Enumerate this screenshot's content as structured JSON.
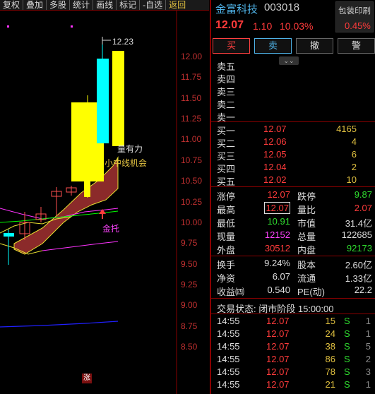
{
  "toolbar": [
    "复权",
    "叠加",
    "多股",
    "统计",
    "画线",
    "标记",
    "-自选",
    "返回"
  ],
  "chart": {
    "y_ticks": [
      "12.00",
      "11.75",
      "11.50",
      "11.25",
      "11.00",
      "10.75",
      "10.50",
      "10.25",
      "10.00",
      "9.75",
      "9.50",
      "9.25",
      "9.00",
      "8.75",
      "8.50"
    ],
    "high_label": "12.23",
    "annotations": [
      "量有力",
      "小中线机会",
      "金托"
    ],
    "zhang_badge": "涨",
    "colors": {
      "up_candle": "#ffff00",
      "cyan_candle": "#00ffff",
      "band_fill": "#8b2a2a",
      "ma_green": "#00ff00",
      "ma_magenta": "#ff33ff",
      "ma_blue": "#2020ff"
    }
  },
  "stock": {
    "name": "金富科技",
    "code": "003018",
    "price": "12.07",
    "change": "1.10",
    "change_pct": "10.03%",
    "baoyou_label": "包装印刷",
    "baoyou_pct": "0.45%"
  },
  "trade_buttons": [
    "买",
    "卖",
    "撤",
    "警"
  ],
  "sell_orders": [
    {
      "label": "卖五",
      "price": "",
      "vol": ""
    },
    {
      "label": "卖四",
      "price": "",
      "vol": ""
    },
    {
      "label": "卖三",
      "price": "",
      "vol": ""
    },
    {
      "label": "卖二",
      "price": "",
      "vol": ""
    },
    {
      "label": "卖一",
      "price": "",
      "vol": ""
    }
  ],
  "buy_orders": [
    {
      "label": "买一",
      "price": "12.07",
      "vol": "4165"
    },
    {
      "label": "买二",
      "price": "12.06",
      "vol": "4"
    },
    {
      "label": "买三",
      "price": "12.05",
      "vol": "6"
    },
    {
      "label": "买四",
      "price": "12.04",
      "vol": "2"
    },
    {
      "label": "买五",
      "price": "12.02",
      "vol": "10"
    }
  ],
  "quote": [
    {
      "k1": "涨停",
      "v1": "12.07",
      "c1": "red",
      "k2": "跌停",
      "v2": "9.87",
      "c2": "green"
    },
    {
      "k1": "最高",
      "v1": "12.07",
      "c1": "red",
      "k2": "量比",
      "v2": "2.07",
      "c2": "red"
    },
    {
      "k1": "最低",
      "v1": "10.91",
      "c1": "green",
      "k2": "市值",
      "v2": "31.4亿",
      "c2": "white"
    },
    {
      "k1": "现量",
      "v1": "12152",
      "c1": "purple",
      "k2": "总量",
      "v2": "122685",
      "c2": "white"
    },
    {
      "k1": "外盘",
      "v1": "30512",
      "c1": "red",
      "k2": "内盘",
      "v2": "92173",
      "c2": "green"
    }
  ],
  "fundamentals": [
    {
      "k1": "换手",
      "v1": "9.24%",
      "k2": "股本",
      "v2": "2.60亿"
    },
    {
      "k1": "净资",
      "v1": "6.07",
      "k2": "流通",
      "v2": "1.33亿"
    },
    {
      "k1": "收益㈣",
      "v1": "0.540",
      "k2": "PE(动)",
      "v2": "22.2"
    }
  ],
  "trade_status": "交易状态: 闭市阶段 15:00:00",
  "ticks": [
    {
      "time": "14:55",
      "price": "12.07",
      "vol": "15",
      "side": "S",
      "num": "1"
    },
    {
      "time": "14:55",
      "price": "12.07",
      "vol": "24",
      "side": "S",
      "num": "1"
    },
    {
      "time": "14:55",
      "price": "12.07",
      "vol": "38",
      "side": "S",
      "num": "5"
    },
    {
      "time": "14:55",
      "price": "12.07",
      "vol": "86",
      "side": "S",
      "num": "2"
    },
    {
      "time": "14:55",
      "price": "12.07",
      "vol": "78",
      "side": "S",
      "num": "3"
    },
    {
      "time": "14:55",
      "price": "12.07",
      "vol": "21",
      "side": "S",
      "num": "1"
    }
  ]
}
